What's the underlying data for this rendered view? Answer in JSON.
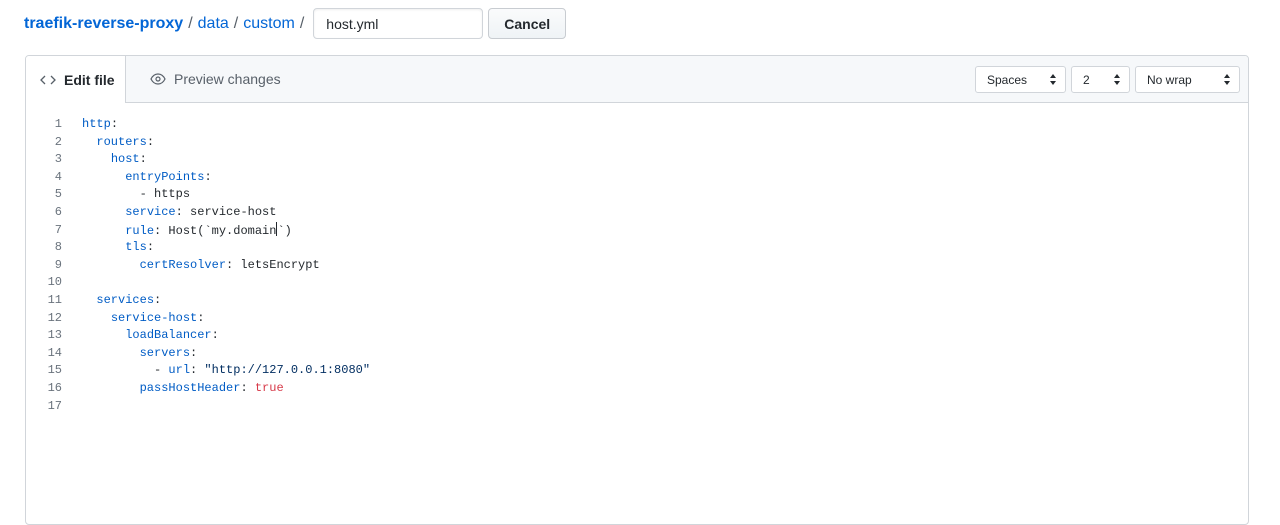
{
  "breadcrumb": {
    "repo": "traefik-reverse-proxy",
    "sep1": "/",
    "folder1": "data",
    "sep2": "/",
    "folder2": "custom",
    "sep3": "/"
  },
  "filename": {
    "value": "host.yml"
  },
  "cancel_label": "Cancel",
  "tabs": {
    "edit_label": "Edit file",
    "preview_label": "Preview changes"
  },
  "editor_options": {
    "indent_mode": "Spaces",
    "indent_size": "2",
    "wrap_mode": "No wrap"
  },
  "code": {
    "lines": [
      {
        "n": "1",
        "indent": "",
        "key": "http",
        "punct": ":",
        "val": "",
        "type": ""
      },
      {
        "n": "2",
        "indent": "  ",
        "key": "routers",
        "punct": ":",
        "val": "",
        "type": ""
      },
      {
        "n": "3",
        "indent": "    ",
        "key": "host",
        "punct": ":",
        "val": "",
        "type": ""
      },
      {
        "n": "4",
        "indent": "      ",
        "key": "entryPoints",
        "punct": ":",
        "val": "",
        "type": ""
      },
      {
        "n": "5",
        "indent": "        ",
        "key": "",
        "punct": "",
        "val": "- https",
        "type": "plain"
      },
      {
        "n": "6",
        "indent": "      ",
        "key": "service",
        "punct": ":",
        "val": " service-host",
        "type": "plain"
      },
      {
        "n": "7",
        "indent": "      ",
        "key": "rule",
        "punct": ":",
        "val": " Host(`my.domain`)",
        "type": "cursor"
      },
      {
        "n": "8",
        "indent": "      ",
        "key": "tls",
        "punct": ":",
        "val": "",
        "type": ""
      },
      {
        "n": "9",
        "indent": "        ",
        "key": "certResolver",
        "punct": ":",
        "val": " letsEncrypt",
        "type": "plain"
      },
      {
        "n": "10",
        "indent": "",
        "key": "",
        "punct": "",
        "val": "",
        "type": ""
      },
      {
        "n": "11",
        "indent": "  ",
        "key": "services",
        "punct": ":",
        "val": "",
        "type": ""
      },
      {
        "n": "12",
        "indent": "    ",
        "key": "service-host",
        "punct": ":",
        "val": "",
        "type": ""
      },
      {
        "n": "13",
        "indent": "      ",
        "key": "loadBalancer",
        "punct": ":",
        "val": "",
        "type": ""
      },
      {
        "n": "14",
        "indent": "        ",
        "key": "servers",
        "punct": ":",
        "val": "",
        "type": ""
      },
      {
        "n": "15",
        "indent": "          ",
        "key": "url",
        "punct": ":",
        "val": " \"http://127.0.0.1:8080\"",
        "type": "dashstring"
      },
      {
        "n": "16",
        "indent": "        ",
        "key": "passHostHeader",
        "punct": ":",
        "val": " true",
        "type": "bool"
      },
      {
        "n": "17",
        "indent": "",
        "key": "",
        "punct": "",
        "val": "",
        "type": ""
      }
    ]
  },
  "colors": {
    "link": "#0366d6",
    "yaml_key": "#005cc5",
    "yaml_string": "#032f62",
    "yaml_bool": "#d73a49",
    "line_number": "#6a737d"
  },
  "icons": {
    "edit_tab": "code-icon",
    "preview_tab": "eye-icon",
    "select_caret": "select-caret-icon"
  }
}
